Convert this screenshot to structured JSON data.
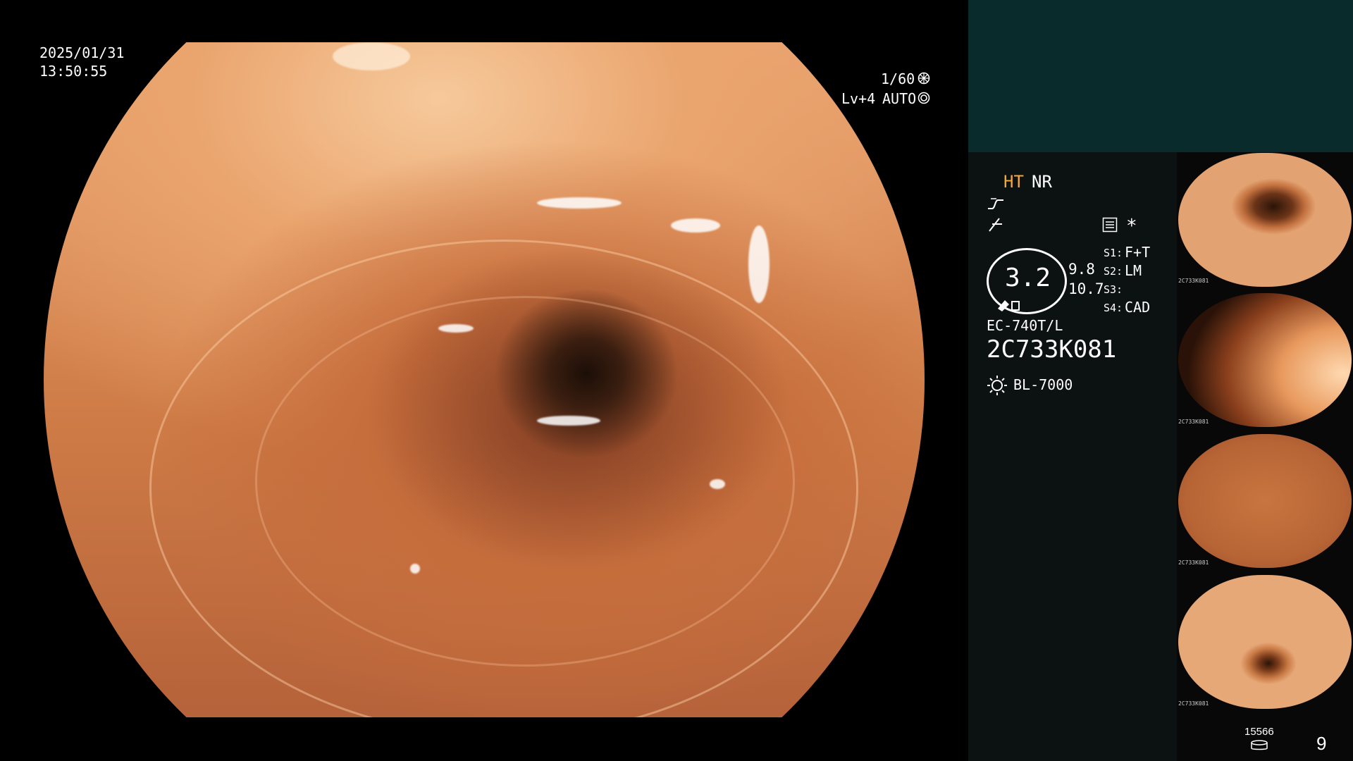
{
  "overlay": {
    "date": "2025/01/31",
    "time": "13:50:55",
    "shutter": "1/60",
    "level": "Lv+4",
    "mode": "AUTO"
  },
  "panel": {
    "ht": "HT",
    "nr": "NR",
    "zoom": "3.2",
    "value_a": "9.8",
    "value_b": "10.7",
    "s1_key": "S1:",
    "s1_val": "F+T",
    "s2_key": "S2:",
    "s2_val": "LM",
    "s3_key": "S3:",
    "s3_val": "",
    "s4_key": "S4:",
    "s4_val": "CAD",
    "asterisk": "*",
    "scope_model": "EC-740T/L",
    "scope_serial": "2C733K081",
    "light_source": "BL-7000",
    "counter": "15566",
    "image_count": "9"
  },
  "thumbnails": [
    {
      "label": "2C733K081"
    },
    {
      "label": "2C733K081"
    },
    {
      "label": "2C733K081"
    },
    {
      "label": "2C733K081"
    }
  ],
  "colors": {
    "accent_ht": "#f3a83a",
    "panel_top": "#0a2b2b",
    "panel_body": "#0c1111"
  },
  "icons": [
    "aperture-icon",
    "iris-icon",
    "gamma-curve-icon",
    "enhance-icon",
    "menu-list-icon",
    "light-source-icon",
    "disk-icon"
  ]
}
